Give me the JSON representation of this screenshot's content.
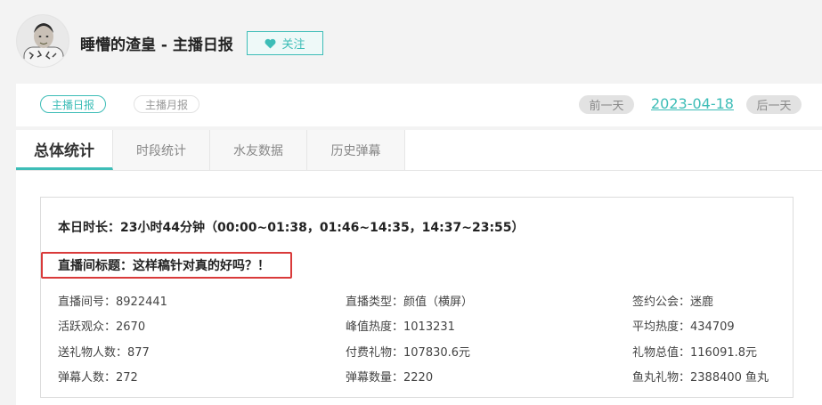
{
  "header": {
    "title": "睡懵的渣皇 - 主播日报",
    "follow_label": "关注"
  },
  "subbar": {
    "daily_label": "主播日报",
    "monthly_label": "主播月报",
    "prev_label": "前一天",
    "date": "2023-04-18",
    "next_label": "后一天"
  },
  "tabs": [
    "总体统计",
    "时段统计",
    "水友数据",
    "历史弹幕"
  ],
  "summary": {
    "duration": "本日时长：23小时44分钟（00:00~01:38，01:46~14:35，14:37~23:55）",
    "stream_title": "直播间标题：这样稿针对真的好吗？！"
  },
  "stats": [
    [
      "直播间号：8922441",
      "直播类型：颜值（横屏）",
      "签约公会：迷鹿"
    ],
    [
      "活跃观众：2670",
      "峰值热度：1013231",
      "平均热度：434709"
    ],
    [
      "送礼物人数：877",
      "付费礼物：107830.6元",
      "礼物总值：116091.8元"
    ],
    [
      "弹幕人数：272",
      "弹幕数量：2220",
      "鱼丸礼物：2388400 鱼丸"
    ]
  ],
  "colors": {
    "accent": "#3dbdb7",
    "highlight_border": "#d93a3a"
  }
}
